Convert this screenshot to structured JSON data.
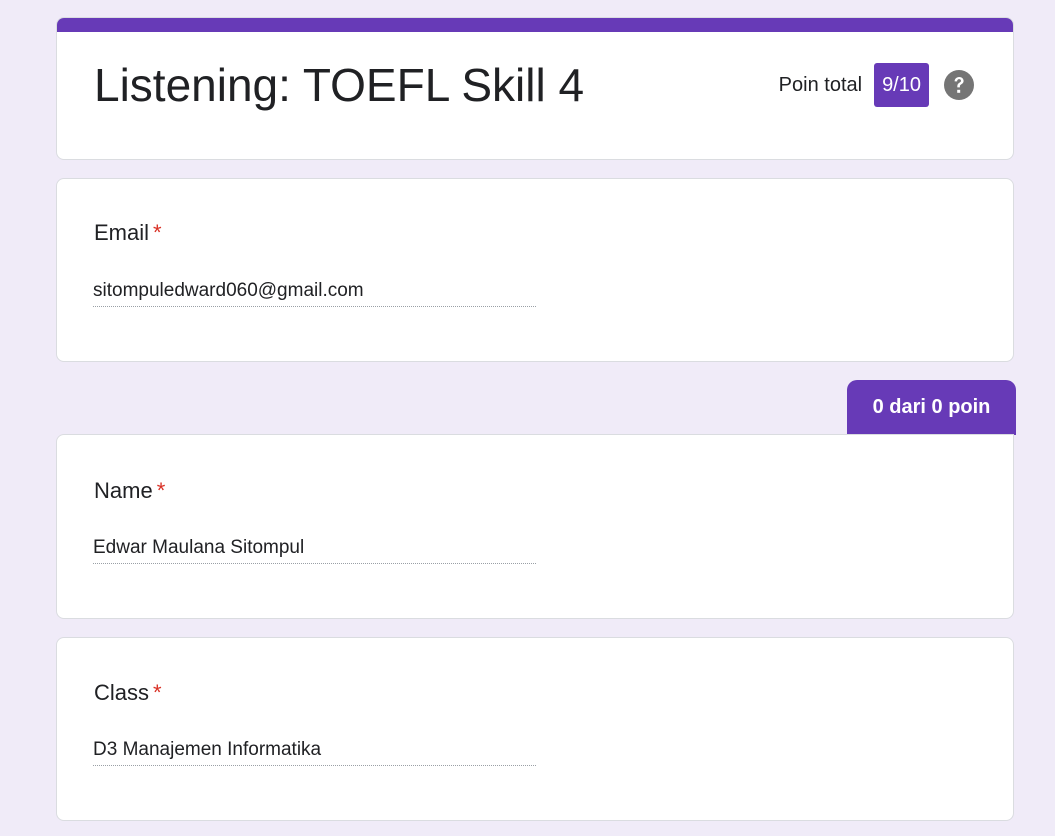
{
  "form": {
    "title": "Listening: TOEFL Skill 4",
    "score_label": "Poin total",
    "score_value": "9/10",
    "accent_color": "#673ab7",
    "help_icon": "help-circle-icon"
  },
  "questions": [
    {
      "label": "Email",
      "required_mark": "*",
      "answer": "sitompuledward060@gmail.com"
    },
    {
      "label": "Name",
      "required_mark": "*",
      "answer": "Edwar Maulana Sitompul",
      "points": "0 dari 0 poin"
    },
    {
      "label": "Class",
      "required_mark": "*",
      "answer": "D3 Manajemen Informatika"
    }
  ]
}
